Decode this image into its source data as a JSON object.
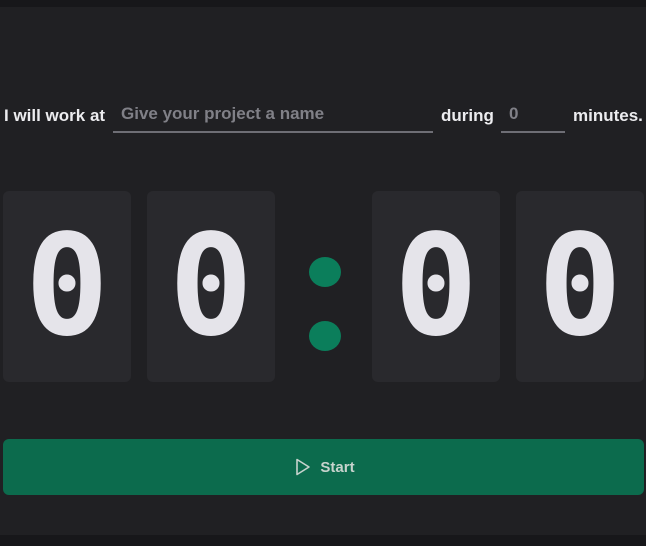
{
  "form": {
    "prefix": "I will work at",
    "project_value": "",
    "project_placeholder": "Give your project a name",
    "during": "during",
    "minutes_value": "",
    "minutes_placeholder": "0",
    "suffix": "minutes."
  },
  "timer": {
    "minute_tens": "0",
    "minute_ones": "0",
    "second_tens": "0",
    "second_ones": "0"
  },
  "start_button": {
    "label": "Start",
    "icon": "play-icon"
  },
  "colors": {
    "background": "#202023",
    "digit_card": "#29292d",
    "accent": "#0b7e5b",
    "button": "#0c6b4d"
  }
}
